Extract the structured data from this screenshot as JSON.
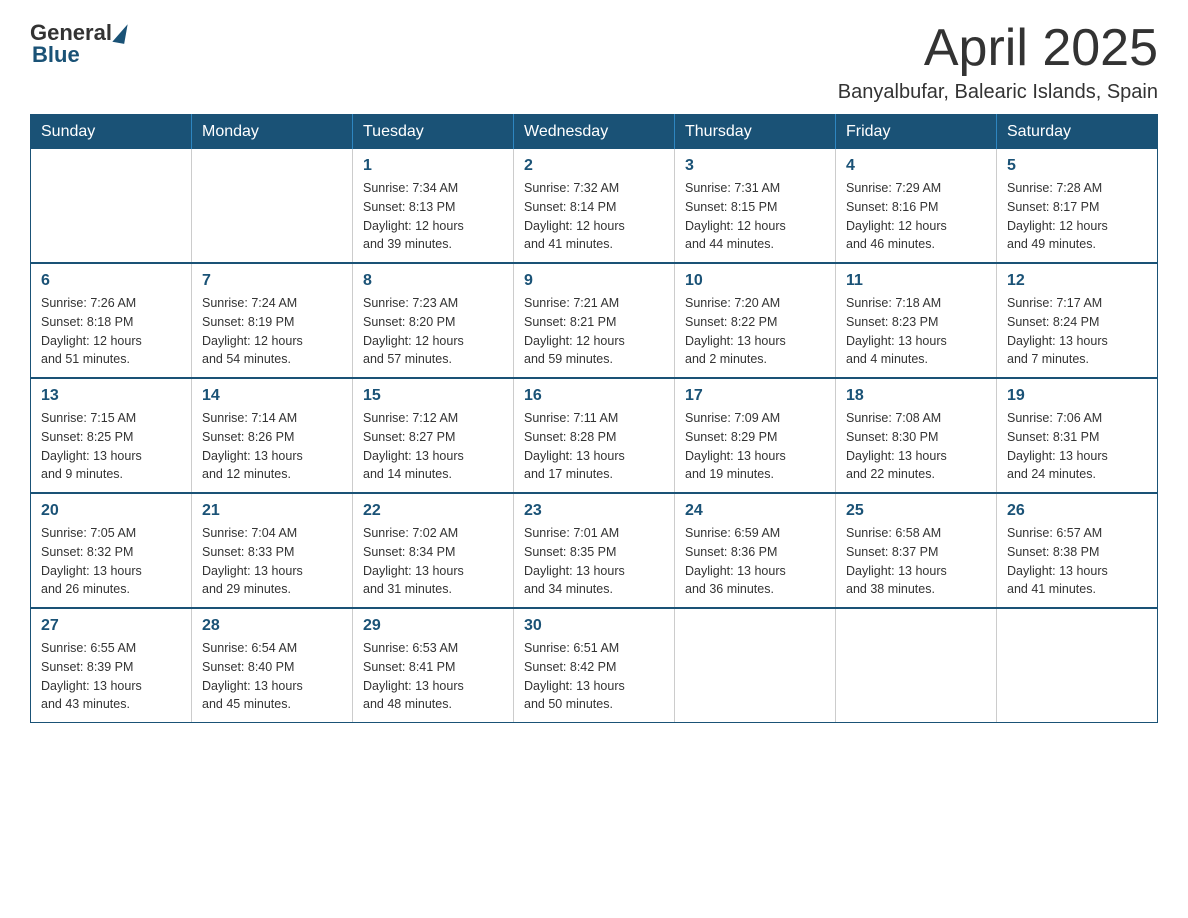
{
  "header": {
    "logo_general": "General",
    "logo_blue": "Blue",
    "month_title": "April 2025",
    "location": "Banyalbufar, Balearic Islands, Spain"
  },
  "weekdays": [
    "Sunday",
    "Monday",
    "Tuesday",
    "Wednesday",
    "Thursday",
    "Friday",
    "Saturday"
  ],
  "weeks": [
    [
      {
        "day": "",
        "info": ""
      },
      {
        "day": "",
        "info": ""
      },
      {
        "day": "1",
        "info": "Sunrise: 7:34 AM\nSunset: 8:13 PM\nDaylight: 12 hours\nand 39 minutes."
      },
      {
        "day": "2",
        "info": "Sunrise: 7:32 AM\nSunset: 8:14 PM\nDaylight: 12 hours\nand 41 minutes."
      },
      {
        "day": "3",
        "info": "Sunrise: 7:31 AM\nSunset: 8:15 PM\nDaylight: 12 hours\nand 44 minutes."
      },
      {
        "day": "4",
        "info": "Sunrise: 7:29 AM\nSunset: 8:16 PM\nDaylight: 12 hours\nand 46 minutes."
      },
      {
        "day": "5",
        "info": "Sunrise: 7:28 AM\nSunset: 8:17 PM\nDaylight: 12 hours\nand 49 minutes."
      }
    ],
    [
      {
        "day": "6",
        "info": "Sunrise: 7:26 AM\nSunset: 8:18 PM\nDaylight: 12 hours\nand 51 minutes."
      },
      {
        "day": "7",
        "info": "Sunrise: 7:24 AM\nSunset: 8:19 PM\nDaylight: 12 hours\nand 54 minutes."
      },
      {
        "day": "8",
        "info": "Sunrise: 7:23 AM\nSunset: 8:20 PM\nDaylight: 12 hours\nand 57 minutes."
      },
      {
        "day": "9",
        "info": "Sunrise: 7:21 AM\nSunset: 8:21 PM\nDaylight: 12 hours\nand 59 minutes."
      },
      {
        "day": "10",
        "info": "Sunrise: 7:20 AM\nSunset: 8:22 PM\nDaylight: 13 hours\nand 2 minutes."
      },
      {
        "day": "11",
        "info": "Sunrise: 7:18 AM\nSunset: 8:23 PM\nDaylight: 13 hours\nand 4 minutes."
      },
      {
        "day": "12",
        "info": "Sunrise: 7:17 AM\nSunset: 8:24 PM\nDaylight: 13 hours\nand 7 minutes."
      }
    ],
    [
      {
        "day": "13",
        "info": "Sunrise: 7:15 AM\nSunset: 8:25 PM\nDaylight: 13 hours\nand 9 minutes."
      },
      {
        "day": "14",
        "info": "Sunrise: 7:14 AM\nSunset: 8:26 PM\nDaylight: 13 hours\nand 12 minutes."
      },
      {
        "day": "15",
        "info": "Sunrise: 7:12 AM\nSunset: 8:27 PM\nDaylight: 13 hours\nand 14 minutes."
      },
      {
        "day": "16",
        "info": "Sunrise: 7:11 AM\nSunset: 8:28 PM\nDaylight: 13 hours\nand 17 minutes."
      },
      {
        "day": "17",
        "info": "Sunrise: 7:09 AM\nSunset: 8:29 PM\nDaylight: 13 hours\nand 19 minutes."
      },
      {
        "day": "18",
        "info": "Sunrise: 7:08 AM\nSunset: 8:30 PM\nDaylight: 13 hours\nand 22 minutes."
      },
      {
        "day": "19",
        "info": "Sunrise: 7:06 AM\nSunset: 8:31 PM\nDaylight: 13 hours\nand 24 minutes."
      }
    ],
    [
      {
        "day": "20",
        "info": "Sunrise: 7:05 AM\nSunset: 8:32 PM\nDaylight: 13 hours\nand 26 minutes."
      },
      {
        "day": "21",
        "info": "Sunrise: 7:04 AM\nSunset: 8:33 PM\nDaylight: 13 hours\nand 29 minutes."
      },
      {
        "day": "22",
        "info": "Sunrise: 7:02 AM\nSunset: 8:34 PM\nDaylight: 13 hours\nand 31 minutes."
      },
      {
        "day": "23",
        "info": "Sunrise: 7:01 AM\nSunset: 8:35 PM\nDaylight: 13 hours\nand 34 minutes."
      },
      {
        "day": "24",
        "info": "Sunrise: 6:59 AM\nSunset: 8:36 PM\nDaylight: 13 hours\nand 36 minutes."
      },
      {
        "day": "25",
        "info": "Sunrise: 6:58 AM\nSunset: 8:37 PM\nDaylight: 13 hours\nand 38 minutes."
      },
      {
        "day": "26",
        "info": "Sunrise: 6:57 AM\nSunset: 8:38 PM\nDaylight: 13 hours\nand 41 minutes."
      }
    ],
    [
      {
        "day": "27",
        "info": "Sunrise: 6:55 AM\nSunset: 8:39 PM\nDaylight: 13 hours\nand 43 minutes."
      },
      {
        "day": "28",
        "info": "Sunrise: 6:54 AM\nSunset: 8:40 PM\nDaylight: 13 hours\nand 45 minutes."
      },
      {
        "day": "29",
        "info": "Sunrise: 6:53 AM\nSunset: 8:41 PM\nDaylight: 13 hours\nand 48 minutes."
      },
      {
        "day": "30",
        "info": "Sunrise: 6:51 AM\nSunset: 8:42 PM\nDaylight: 13 hours\nand 50 minutes."
      },
      {
        "day": "",
        "info": ""
      },
      {
        "day": "",
        "info": ""
      },
      {
        "day": "",
        "info": ""
      }
    ]
  ]
}
